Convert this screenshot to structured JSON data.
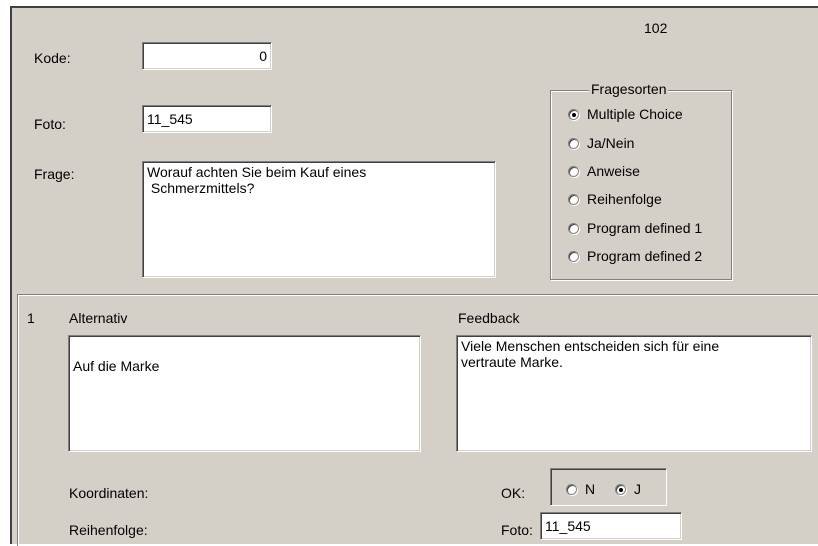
{
  "header": {
    "record_number": "102"
  },
  "form": {
    "kode_label": "Kode:",
    "kode_value": "0",
    "foto_label": "Foto:",
    "foto_value": "11_545",
    "frage_label": "Frage:",
    "frage_value": "Worauf achten Sie beim Kauf eines\n Schmerzmittels?"
  },
  "fragesorten": {
    "title": "Fragesorten",
    "selected_index": 0,
    "options": [
      "Multiple Choice",
      "Ja/Nein",
      "Anweise",
      "Reihenfolge",
      "Program defined 1",
      "Program defined 2"
    ]
  },
  "alternative": {
    "number": "1",
    "alternativ_label": "Alternativ",
    "alternativ_value": "Auf die Marke",
    "feedback_label": "Feedback",
    "feedback_value": "Viele Menschen entscheiden sich für eine\nvertraute Marke.",
    "koordinaten_label": "Koordinaten:",
    "reihenfolge_label": "Reihenfolge:",
    "ok_label": "OK:",
    "ok_options": [
      "N",
      "J"
    ],
    "ok_selected": "J",
    "foto_label": "Foto:",
    "foto_value": "11_545"
  }
}
